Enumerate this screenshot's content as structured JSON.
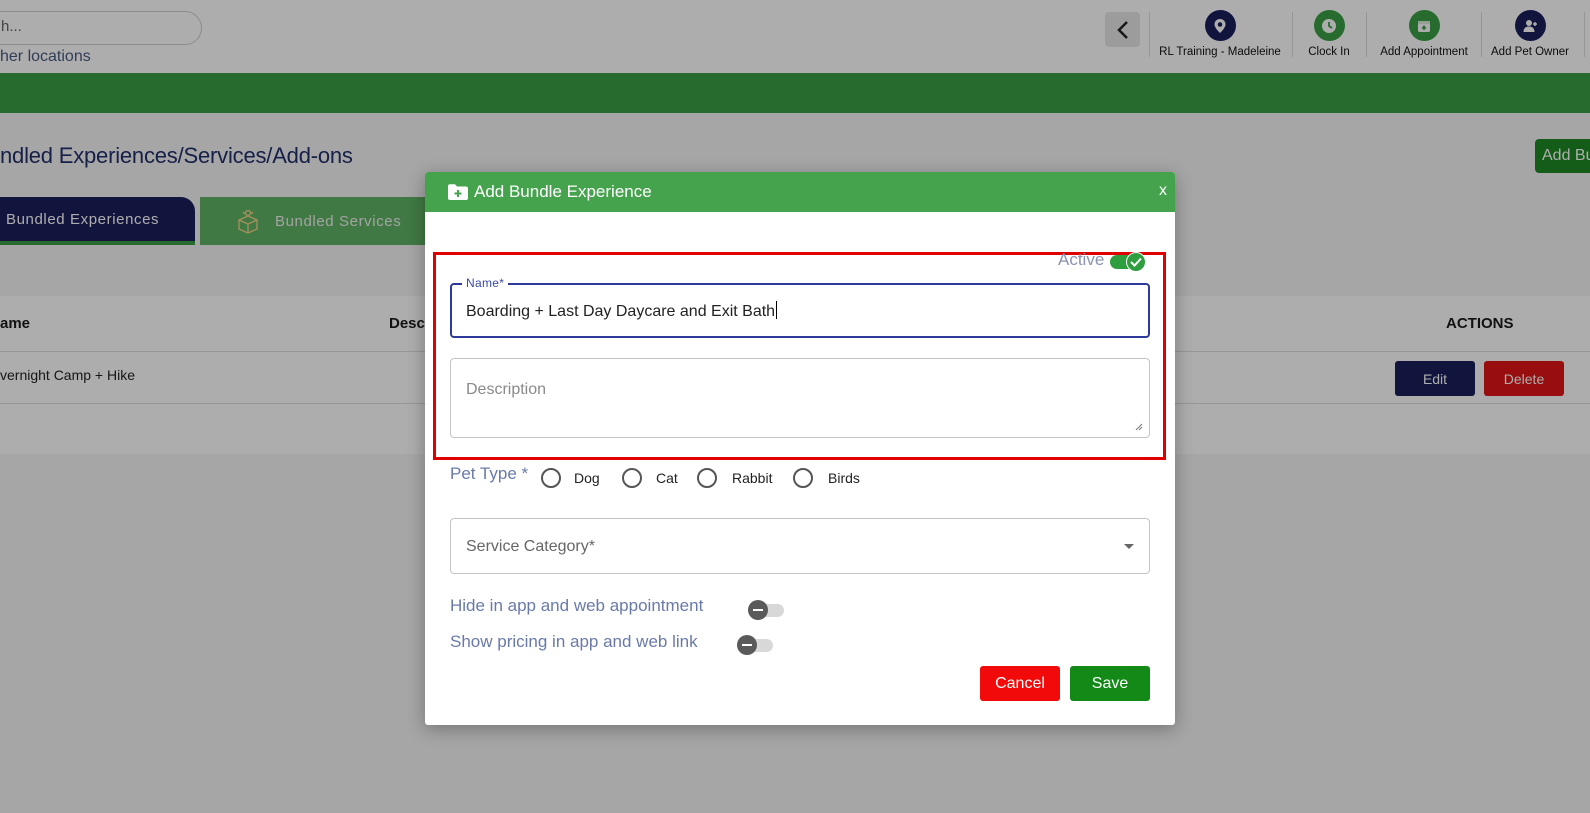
{
  "search": {
    "value": "h..."
  },
  "location_link": "her locations",
  "top_actions": [
    {
      "label": "RL Training - Madeleine",
      "icon": "location-pin-icon",
      "color": "#1a1f5c"
    },
    {
      "label": "Clock In",
      "icon": "clock-icon",
      "color": "#3a9e44"
    },
    {
      "label": "Add Appointment",
      "icon": "calendar-add-icon",
      "color": "#3a9e44"
    },
    {
      "label": "Add Pet Owner",
      "icon": "add-user-icon",
      "color": "#1a1f5c"
    }
  ],
  "page": {
    "title": "ndled Experiences/Services/Add-ons",
    "add_button": "Add Bu",
    "tabs": [
      {
        "label": "Bundled Experiences",
        "active": true
      },
      {
        "label": "Bundled Services",
        "active": false
      }
    ]
  },
  "table": {
    "headers": [
      "ame",
      "Desc",
      "ACTIONS"
    ],
    "rows": [
      {
        "name": "vernight Camp + Hike",
        "edit": "Edit",
        "delete": "Delete"
      }
    ]
  },
  "modal": {
    "title": "Add Bundle Experience",
    "close": "x",
    "active_label": "Active",
    "active": true,
    "name_label": "Name*",
    "name_value": "Boarding + Last Day Daycare and Exit Bath",
    "description_placeholder": "Description",
    "pet_type_label": "Pet Type *",
    "pet_types": [
      "Dog",
      "Cat",
      "Rabbit",
      "Birds"
    ],
    "category_placeholder": "Service Category*",
    "hide_label": "Hide in app and web appointment",
    "hide_enabled": false,
    "pricing_label": "Show pricing in app and web link",
    "pricing_enabled": false,
    "cancel": "Cancel",
    "save": "Save"
  },
  "colors": {
    "brand_green": "#3a9e44",
    "brand_navy": "#1a1f5c",
    "danger": "#f20a0a",
    "highlight_frame": "#e00000"
  }
}
